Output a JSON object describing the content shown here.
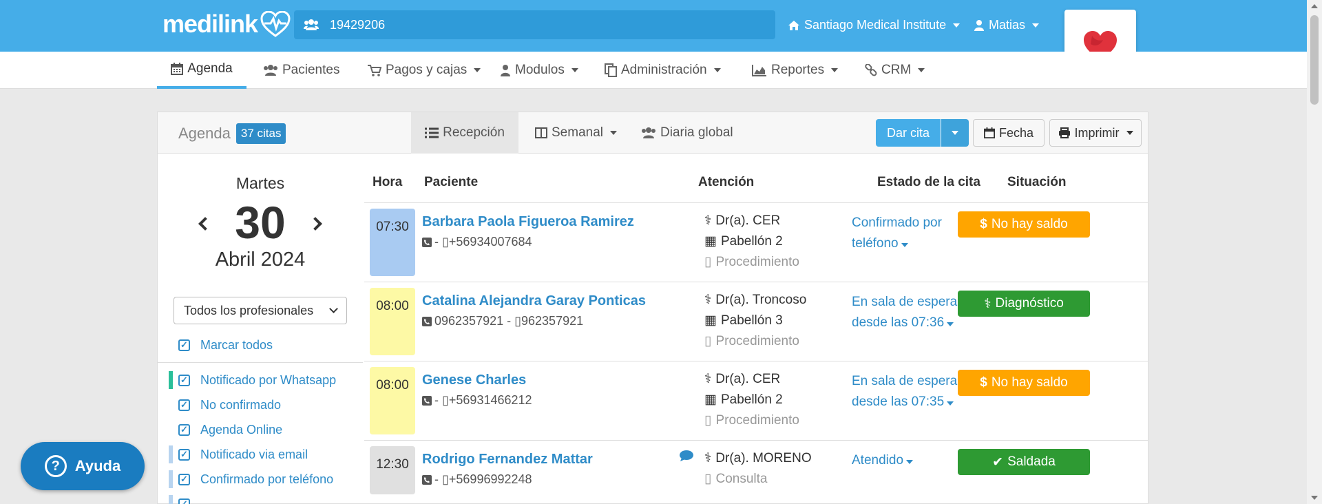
{
  "topbar": {
    "logo_text": "medilink",
    "search_value": "19429206",
    "institute_label": "Santiago Medical Institute",
    "user_label": "Matias"
  },
  "nav": {
    "items": [
      {
        "label": "Agenda",
        "icon": "calendar-icon",
        "active": true
      },
      {
        "label": "Pacientes",
        "icon": "users-icon"
      },
      {
        "label": "Pagos y cajas",
        "icon": "cart-icon"
      },
      {
        "label": "Modulos",
        "icon": "doctor-icon"
      },
      {
        "label": "Administración",
        "icon": "copy-icon"
      },
      {
        "label": "Reportes",
        "icon": "area-chart-icon"
      },
      {
        "label": "CRM",
        "icon": "link-icon"
      }
    ]
  },
  "panel": {
    "title": "Agenda",
    "count_badge": "37 citas",
    "tabs": [
      {
        "label": "Recepción",
        "active": true
      },
      {
        "label": "Semanal"
      },
      {
        "label": "Diaria global"
      }
    ],
    "buttons": {
      "dar_cita": "Dar cita",
      "fecha": "Fecha",
      "imprimir": "Imprimir"
    }
  },
  "calendar": {
    "day_name": "Martes",
    "day_number": "30",
    "month_year": "Abril 2024"
  },
  "filters": {
    "professional_select": "Todos los profesionales",
    "items": [
      {
        "label": "Marcar todos",
        "bar_color": ""
      },
      {
        "label": "Notificado por Whatsapp",
        "bar_color": "#2bbf9a"
      },
      {
        "label": "No confirmado",
        "bar_color": ""
      },
      {
        "label": "Agenda Online",
        "bar_color": ""
      },
      {
        "label": "Notificado via email",
        "bar_color": "#b8d4f0"
      },
      {
        "label": "Confirmado por teléfono",
        "bar_color": "#b8d4f0"
      }
    ]
  },
  "table": {
    "headers": [
      "Hora",
      "Paciente",
      "Atención",
      "Estado de la cita",
      "Situación"
    ],
    "rows": [
      {
        "time": "07:30",
        "time_bg": "#a9cbf2",
        "patient": "Barbara Paola Figueroa Ramirez",
        "phone": "- ▯+56934007684",
        "doctor": "Dr(a). CER",
        "room": "Pabellón 2",
        "type": "Procedimiento",
        "estado": "Confirmado por teléfono",
        "situacion": "No hay saldo",
        "sit_color": "#ffa500",
        "sit_icon": "$",
        "chat": false
      },
      {
        "time": "08:00",
        "time_bg": "#fdf9a5",
        "patient": "Catalina Alejandra Garay Ponticas",
        "phone": "0962357921 - ▯962357921",
        "doctor": "Dr(a). Troncoso",
        "room": "Pabellón 3",
        "type": "Procedimiento",
        "estado": "En sala de espera desde las 07:36",
        "situacion": "Diagnóstico",
        "sit_color": "#2e9a33",
        "sit_icon": "⚕",
        "chat": false
      },
      {
        "time": "08:00",
        "time_bg": "#fdf9a5",
        "patient": "Genese Charles",
        "phone": "- ▯+56931466212",
        "doctor": "Dr(a). CER",
        "room": "Pabellón 2",
        "type": "Procedimiento",
        "estado": "En sala de espera desde las 07:35",
        "situacion": "No hay saldo",
        "sit_color": "#ffa500",
        "sit_icon": "$",
        "chat": false
      },
      {
        "time": "12:30",
        "time_bg": "#e0e0e0",
        "patient": "Rodrigo Fernandez Mattar",
        "phone": "- ▯+56996992248",
        "doctor": "Dr(a). MORENO",
        "room": "",
        "type": "Consulta",
        "estado": "Atendido",
        "situacion": "Saldada",
        "sit_color": "#2e9a33",
        "sit_icon": "✔",
        "chat": true
      }
    ]
  },
  "help": {
    "label": "Ayuda"
  }
}
